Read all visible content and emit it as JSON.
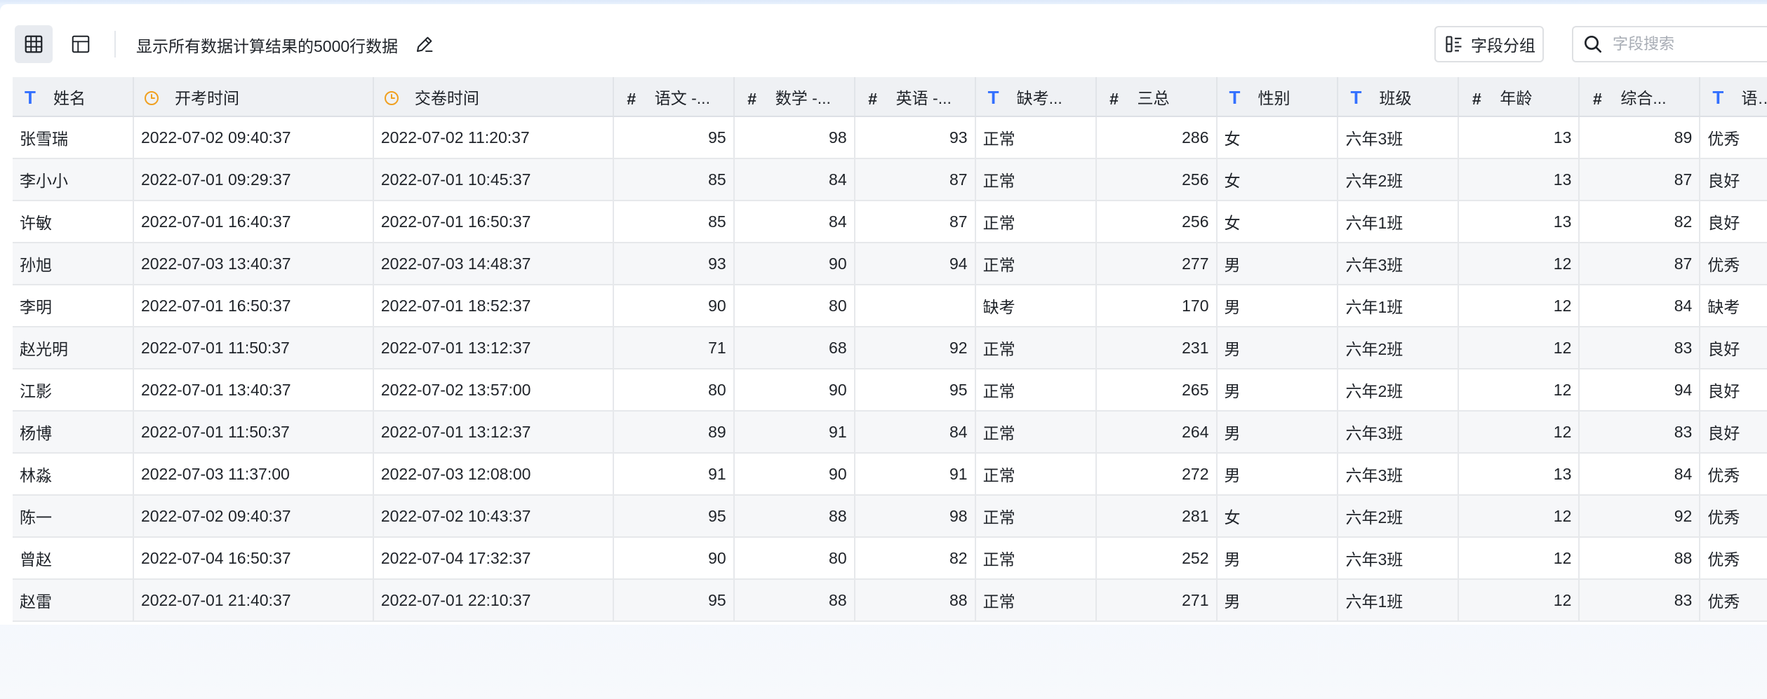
{
  "toolbar": {
    "title": "显示所有数据计算结果的5000行数据",
    "group_label": "字段分组",
    "search_placeholder": "字段搜索"
  },
  "colors": {
    "text_field_icon": "#3370ff",
    "number_field_icon": "#2db78b",
    "time_field_icon": "#f0a020"
  },
  "table": {
    "columns": [
      {
        "label": "姓名",
        "type": "text"
      },
      {
        "label": "开考时间",
        "type": "time"
      },
      {
        "label": "交卷时间",
        "type": "time"
      },
      {
        "label": "语文 -...",
        "type": "number"
      },
      {
        "label": "数学 -...",
        "type": "number"
      },
      {
        "label": "英语 -...",
        "type": "number"
      },
      {
        "label": "缺考...",
        "type": "text"
      },
      {
        "label": "三总",
        "type": "number"
      },
      {
        "label": "性别",
        "type": "text"
      },
      {
        "label": "班级",
        "type": "text"
      },
      {
        "label": "年龄",
        "type": "number"
      },
      {
        "label": "综合...",
        "type": "number"
      },
      {
        "label": "语文...",
        "type": "text"
      }
    ],
    "rows": [
      [
        "张雪瑞",
        "2022-07-02 09:40:37",
        "2022-07-02 11:20:37",
        "95",
        "98",
        "93",
        "正常",
        "286",
        "女",
        "六年3班",
        "13",
        "89",
        "优秀"
      ],
      [
        "李小小",
        "2022-07-01 09:29:37",
        "2022-07-01 10:45:37",
        "85",
        "84",
        "87",
        "正常",
        "256",
        "女",
        "六年2班",
        "13",
        "87",
        "良好"
      ],
      [
        "许敏",
        "2022-07-01 16:40:37",
        "2022-07-01 16:50:37",
        "85",
        "84",
        "87",
        "正常",
        "256",
        "女",
        "六年1班",
        "13",
        "82",
        "良好"
      ],
      [
        "孙旭",
        "2022-07-03 13:40:37",
        "2022-07-03 14:48:37",
        "93",
        "90",
        "94",
        "正常",
        "277",
        "男",
        "六年3班",
        "12",
        "87",
        "优秀"
      ],
      [
        "李明",
        "2022-07-01 16:50:37",
        "2022-07-01 18:52:37",
        "90",
        "80",
        "",
        "缺考",
        "170",
        "男",
        "六年1班",
        "12",
        "84",
        "缺考"
      ],
      [
        "赵光明",
        "2022-07-01 11:50:37",
        "2022-07-01 13:12:37",
        "71",
        "68",
        "92",
        "正常",
        "231",
        "男",
        "六年2班",
        "12",
        "83",
        "良好"
      ],
      [
        "江影",
        "2022-07-01 13:40:37",
        "2022-07-02 13:57:00",
        "80",
        "90",
        "95",
        "正常",
        "265",
        "男",
        "六年2班",
        "12",
        "94",
        "良好"
      ],
      [
        "杨博",
        "2022-07-01 11:50:37",
        "2022-07-01 13:12:37",
        "89",
        "91",
        "84",
        "正常",
        "264",
        "男",
        "六年3班",
        "12",
        "83",
        "良好"
      ],
      [
        "林淼",
        "2022-07-03 11:37:00",
        "2022-07-03 12:08:00",
        "91",
        "90",
        "91",
        "正常",
        "272",
        "男",
        "六年3班",
        "13",
        "84",
        "优秀"
      ],
      [
        "陈一",
        "2022-07-02 09:40:37",
        "2022-07-02 10:43:37",
        "95",
        "88",
        "98",
        "正常",
        "281",
        "女",
        "六年2班",
        "12",
        "92",
        "优秀"
      ],
      [
        "曾赵",
        "2022-07-04 16:50:37",
        "2022-07-04 17:32:37",
        "90",
        "80",
        "82",
        "正常",
        "252",
        "男",
        "六年3班",
        "12",
        "88",
        "优秀"
      ],
      [
        "赵雷",
        "2022-07-01 21:40:37",
        "2022-07-01 22:10:37",
        "95",
        "88",
        "88",
        "正常",
        "271",
        "男",
        "六年1班",
        "12",
        "83",
        "优秀"
      ]
    ]
  }
}
